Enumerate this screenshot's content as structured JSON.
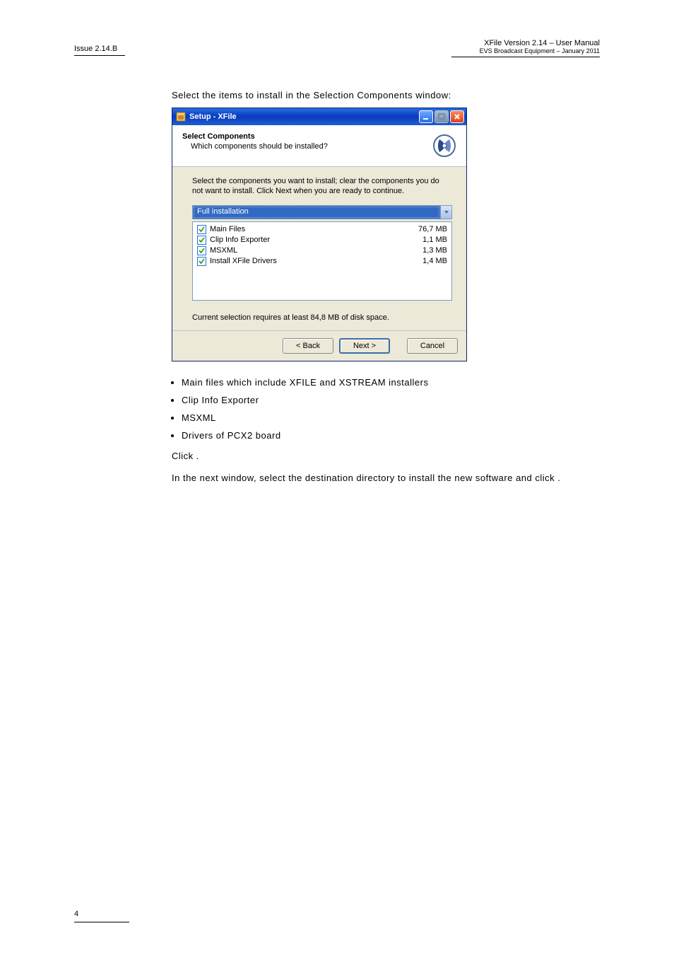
{
  "header": {
    "left": "Issue 2.14.B",
    "right_line1": "XFile Version 2.14 – User Manual",
    "right_line2": "EVS Broadcast Equipment – January 2011"
  },
  "intro_text": "Select the items to install in the Selection Components window:",
  "dialog": {
    "title": "Setup - XFile",
    "header_title": "Select Components",
    "header_sub": "Which components should be installed?",
    "instruction": "Select the components you want to install; clear the components you do not want to install. Click Next when you are ready to continue.",
    "combo_value": "Full installation",
    "items": [
      {
        "label": "Main Files",
        "size": "76,7 MB"
      },
      {
        "label": "Clip Info Exporter",
        "size": "1,1 MB"
      },
      {
        "label": "MSXML",
        "size": "1,3 MB"
      },
      {
        "label": "Install XFile Drivers",
        "size": "1,4 MB"
      }
    ],
    "requirement": "Current selection requires at least 84,8 MB of disk space.",
    "buttons": {
      "back": "< Back",
      "next": "Next >",
      "cancel": "Cancel"
    }
  },
  "bullets": [
    "Main files which include XFILE and XSTREAM installers",
    "Clip Info Exporter",
    "MSXML",
    "Drivers of PCX2 board"
  ],
  "click_text": "Click       .",
  "next_para": "In the next window, select the destination directory to install the new software and click        .",
  "page_number": "4"
}
